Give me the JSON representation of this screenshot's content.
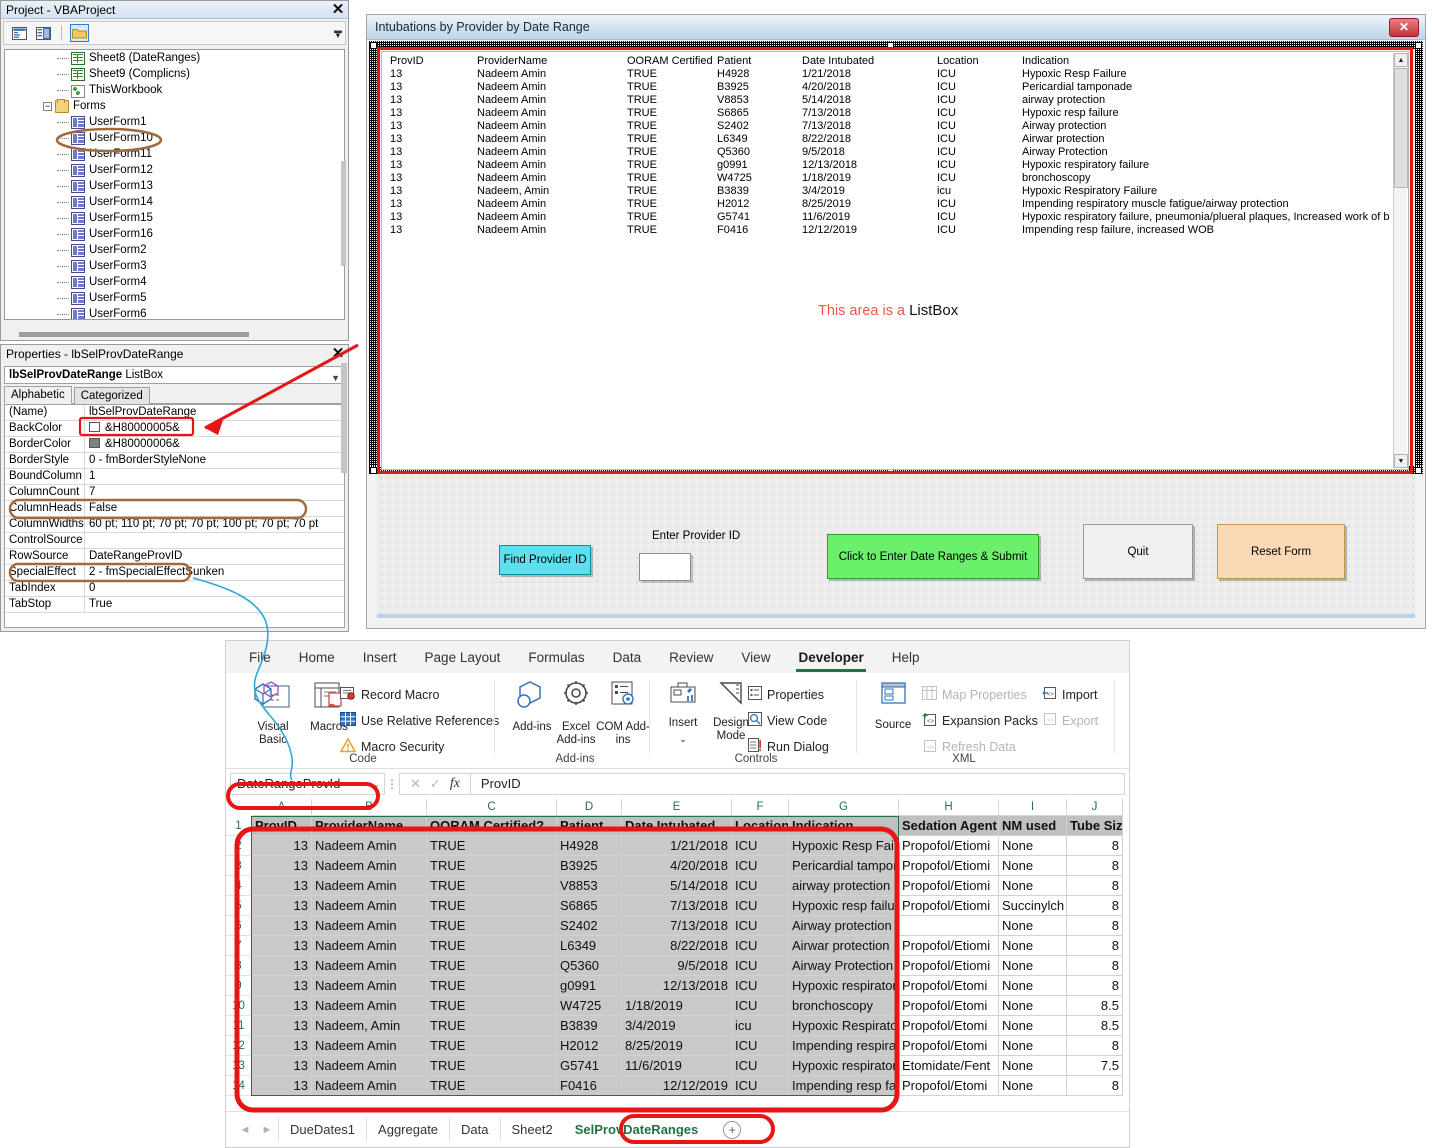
{
  "vbe": {
    "project": {
      "title": "Project - VBAProject",
      "close_label": "✕",
      "toolbar": [
        {
          "name": "view-code-icon",
          "label": "View Code"
        },
        {
          "name": "view-object-icon",
          "label": "View Object"
        },
        {
          "name": "toggle-folders-icon",
          "label": "Toggle Folders"
        }
      ],
      "tree": [
        {
          "label": "Sheet8 (DateRanges)",
          "icon": "sheet-icon",
          "indent": 3,
          "type": "sheet"
        },
        {
          "label": "Sheet9 (Complicns)",
          "icon": "sheet-icon",
          "indent": 3,
          "type": "sheet"
        },
        {
          "label": "ThisWorkbook",
          "icon": "workbook-icon",
          "indent": 3,
          "type": "workbook"
        },
        {
          "label": "Forms",
          "icon": "folder-icon",
          "indent": 2,
          "type": "folder",
          "expander": "−"
        },
        {
          "label": "UserForm1",
          "icon": "form-icon",
          "indent": 3,
          "type": "form"
        },
        {
          "label": "UserForm10",
          "icon": "form-icon",
          "indent": 3,
          "type": "form",
          "highlight": true
        },
        {
          "label": "UserForm11",
          "icon": "form-icon",
          "indent": 3,
          "type": "form"
        },
        {
          "label": "UserForm12",
          "icon": "form-icon",
          "indent": 3,
          "type": "form"
        },
        {
          "label": "UserForm13",
          "icon": "form-icon",
          "indent": 3,
          "type": "form"
        },
        {
          "label": "UserForm14",
          "icon": "form-icon",
          "indent": 3,
          "type": "form"
        },
        {
          "label": "UserForm15",
          "icon": "form-icon",
          "indent": 3,
          "type": "form"
        },
        {
          "label": "UserForm16",
          "icon": "form-icon",
          "indent": 3,
          "type": "form"
        },
        {
          "label": "UserForm2",
          "icon": "form-icon",
          "indent": 3,
          "type": "form"
        },
        {
          "label": "UserForm3",
          "icon": "form-icon",
          "indent": 3,
          "type": "form"
        },
        {
          "label": "UserForm4",
          "icon": "form-icon",
          "indent": 3,
          "type": "form"
        },
        {
          "label": "UserForm5",
          "icon": "form-icon",
          "indent": 3,
          "type": "form"
        },
        {
          "label": "UserForm6",
          "icon": "form-icon",
          "indent": 3,
          "type": "form"
        }
      ]
    },
    "properties": {
      "title": "Properties - lbSelProvDateRange",
      "close_label": "✕",
      "object_name": "lbSelProvDateRange",
      "object_type": "ListBox",
      "tabs": [
        {
          "label": "Alphabetic",
          "active": true
        },
        {
          "label": "Categorized",
          "active": false
        }
      ],
      "rows": [
        {
          "name": "(Name)",
          "value": "lbSelProvDateRange",
          "swatch": null,
          "highlight": "red"
        },
        {
          "name": "BackColor",
          "value": "&H80000005&",
          "swatch": "#ffffff"
        },
        {
          "name": "BorderColor",
          "value": "&H80000006&",
          "swatch": "#808080"
        },
        {
          "name": "BorderStyle",
          "value": "0 - fmBorderStyleNone",
          "swatch": null
        },
        {
          "name": "BoundColumn",
          "value": "1",
          "swatch": null
        },
        {
          "name": "ColumnCount",
          "value": "7",
          "swatch": null
        },
        {
          "name": "ColumnHeads",
          "value": "False",
          "swatch": null
        },
        {
          "name": "ColumnWidths",
          "value": "60 pt; 110 pt; 70 pt; 70 pt; 100 pt; 70 pt; 70 pt",
          "swatch": null,
          "highlight": "brown"
        },
        {
          "name": "ControlSource",
          "value": "",
          "swatch": null
        },
        {
          "name": "RowSource",
          "value": "DateRangeProvID",
          "swatch": null,
          "highlight": "brown"
        },
        {
          "name": "SpecialEffect",
          "value": "2 - fmSpecialEffectSunken",
          "swatch": null
        },
        {
          "name": "TabIndex",
          "value": "0",
          "swatch": null
        },
        {
          "name": "TabStop",
          "value": "True",
          "swatch": null
        }
      ]
    }
  },
  "userform": {
    "title": "Intubations by Provider by Date Range",
    "close_label": "✕",
    "annotation": {
      "prefix": "This area is a ",
      "emphasis": "ListBox"
    },
    "listbox": {
      "header": [
        "ProvID",
        "ProviderName",
        "OORAM Certified",
        "Patient",
        "Date Intubated",
        "Location",
        "Indication"
      ],
      "rows": [
        [
          "13",
          "Nadeem Amin",
          "TRUE",
          "H4928",
          "1/21/2018",
          "ICU",
          "Hypoxic Resp Failure"
        ],
        [
          "13",
          "Nadeem Amin",
          "TRUE",
          "B3925",
          "4/20/2018",
          "ICU",
          "Pericardial tamponade"
        ],
        [
          "13",
          "Nadeem Amin",
          "TRUE",
          "V8853",
          "5/14/2018",
          "ICU",
          "airway protection"
        ],
        [
          "13",
          "Nadeem Amin",
          "TRUE",
          "S6865",
          "7/13/2018",
          "ICU",
          "Hypoxic resp failure"
        ],
        [
          "13",
          "Nadeem Amin",
          "TRUE",
          "S2402",
          "7/13/2018",
          "ICU",
          "Airway protection"
        ],
        [
          "13",
          "Nadeem Amin",
          "TRUE",
          "L6349",
          "8/22/2018",
          "ICU",
          "Airwar protection"
        ],
        [
          "13",
          "Nadeem Amin",
          "TRUE",
          "Q5360",
          "9/5/2018",
          "ICU",
          "Airway Protection"
        ],
        [
          "13",
          "Nadeem Amin",
          "TRUE",
          "g0991",
          "12/13/2018",
          "ICU",
          "Hypoxic respiratory failure"
        ],
        [
          "13",
          "Nadeem Amin",
          "TRUE",
          "W4725",
          "1/18/2019",
          "ICU",
          "bronchoscopy"
        ],
        [
          "13",
          "Nadeem, Amin",
          "TRUE",
          "B3839",
          "3/4/2019",
          "icu",
          "Hypoxic Respiratory Failure"
        ],
        [
          "13",
          "Nadeem Amin",
          "TRUE",
          "H2012",
          "8/25/2019",
          "ICU",
          " Impending respiratory muscle fatigue/airway protection"
        ],
        [
          "13",
          "Nadeem Amin",
          "TRUE",
          "G5741",
          "11/6/2019",
          "ICU",
          "Hypoxic respiratory failure, pneumonia/plueral plaques, Increased work of b"
        ],
        [
          "13",
          "Nadeem Amin",
          "TRUE",
          "F0416",
          "12/12/2019",
          "ICU",
          "Impending resp failure, increased WOB"
        ]
      ]
    },
    "controls": {
      "find_button": "Find Provider ID",
      "provider_label": "Enter Provider ID",
      "provider_input_value": "",
      "submit_button": "Click to Enter Date Ranges & Submit",
      "quit_button": "Quit",
      "reset_button": "Reset Form"
    }
  },
  "excel": {
    "ribbon_tabs": [
      {
        "label": "File",
        "active": false
      },
      {
        "label": "Home",
        "active": false
      },
      {
        "label": "Insert",
        "active": false
      },
      {
        "label": "Page Layout",
        "active": false
      },
      {
        "label": "Formulas",
        "active": false
      },
      {
        "label": "Data",
        "active": false
      },
      {
        "label": "Review",
        "active": false
      },
      {
        "label": "View",
        "active": false
      },
      {
        "label": "Developer",
        "active": true
      },
      {
        "label": "Help",
        "active": false
      }
    ],
    "ribbon_groups": [
      {
        "label": "Code"
      },
      {
        "label": "Add-ins"
      },
      {
        "label": "Controls"
      },
      {
        "label": "XML"
      }
    ],
    "code_group": {
      "visual_basic": "Visual Basic",
      "macros": "Macros",
      "record_macro": "Record Macro",
      "use_relative_references": "Use Relative References",
      "macro_security": "Macro Security"
    },
    "addins_group": {
      "addins": "Add-ins",
      "excel_addins": "Excel Add-ins",
      "com_addins": "COM Add-ins"
    },
    "controls_group": {
      "insert": "Insert",
      "design_mode": "Design Mode",
      "properties": "Properties",
      "view_code": "View Code",
      "run_dialog": "Run Dialog"
    },
    "xml_group": {
      "source": "Source",
      "map_properties": "Map Properties",
      "expansion_packs": "Expansion Packs",
      "refresh_data": "Refresh Data",
      "import": "Import",
      "export": "Export"
    },
    "formula_bar": {
      "name_box": "DateRangeProvId",
      "cancel_icon": "✕",
      "enter_icon": "✓",
      "fx_icon": "fx",
      "formula_value": "ProvID"
    },
    "sheet": {
      "column_headers": [
        "A",
        "B",
        "C",
        "D",
        "E",
        "F",
        "G",
        "H",
        "I",
        "J"
      ],
      "row_numbers": [
        "1",
        "2",
        "3",
        "4",
        "5",
        "6",
        "7",
        "8",
        "9",
        "10",
        "11",
        "12",
        "13",
        "14"
      ],
      "header_row": [
        "ProvID",
        "ProviderName",
        "OORAM Certified?",
        "Patient",
        "Date Intubated",
        "Location",
        "Indication",
        "Sedation Agent",
        "NM used",
        "Tube Size"
      ],
      "rows": [
        [
          "13",
          "Nadeem Amin",
          "TRUE",
          "H4928",
          "1/21/2018",
          "ICU",
          "Hypoxic Resp Failur",
          "Propofol/Etiomi",
          "None",
          "8"
        ],
        [
          "13",
          "Nadeem Amin",
          "TRUE",
          "B3925",
          "4/20/2018",
          "ICU",
          "Pericardial tampon",
          "Propofol/Etiomi",
          "None",
          "8"
        ],
        [
          "13",
          "Nadeem Amin",
          "TRUE",
          "V8853",
          "5/14/2018",
          "ICU",
          "airway protection",
          "Propofol/Etiomi",
          "None",
          "8"
        ],
        [
          "13",
          "Nadeem Amin",
          "TRUE",
          "S6865",
          "7/13/2018",
          "ICU",
          "Hypoxic resp failure",
          "Propofol/Etiomi",
          "Succinylch",
          "8"
        ],
        [
          "13",
          "Nadeem Amin",
          "TRUE",
          "S2402",
          "7/13/2018",
          "ICU",
          "Airway protection",
          "",
          "None",
          "8"
        ],
        [
          "13",
          "Nadeem Amin",
          "TRUE",
          "L6349",
          "8/22/2018",
          "ICU",
          "Airwar protection",
          "Propofol/Etiomi",
          "None",
          "8"
        ],
        [
          "13",
          "Nadeem Amin",
          "TRUE",
          "Q5360",
          "9/5/2018",
          "ICU",
          "Airway Protection",
          "Propofol/Etiomi",
          "None",
          "8"
        ],
        [
          "13",
          "Nadeem Amin",
          "TRUE",
          "g0991",
          "12/13/2018",
          "ICU",
          "Hypoxic respiratory",
          "Propofol/Etomi",
          "None",
          "8"
        ],
        [
          "13",
          "Nadeem Amin",
          "TRUE",
          "W4725",
          "1/18/2019",
          "ICU",
          "bronchoscopy",
          "Propofol/Etomi",
          "None",
          "8.5"
        ],
        [
          "13",
          "Nadeem, Amin",
          "TRUE",
          "B3839",
          "3/4/2019",
          "icu",
          "Hypoxic Respirator",
          "Propofol/Etomi",
          "None",
          "8.5"
        ],
        [
          "13",
          "Nadeem Amin",
          "TRUE",
          "H2012",
          "8/25/2019",
          "ICU",
          " Impending respirat",
          "Propofol/Etomi",
          "None",
          "8"
        ],
        [
          "13",
          "Nadeem Amin",
          "TRUE",
          "G5741",
          "11/6/2019",
          "ICU",
          "Hypoxic respiratory",
          "Etomidate/Fent",
          "None",
          "7.5"
        ],
        [
          "13",
          "Nadeem Amin",
          "TRUE",
          "F0416",
          "12/12/2019",
          "ICU",
          "Impending resp fail",
          "Propofol/Etomi",
          "None",
          "8"
        ]
      ],
      "date_right_aligned": [
        true,
        true,
        true,
        true,
        true,
        true,
        true,
        true,
        false,
        false,
        false,
        false,
        true
      ]
    },
    "sheet_tabs": [
      {
        "label": "DueDates1",
        "active": false
      },
      {
        "label": "Aggregate",
        "active": false
      },
      {
        "label": "Data",
        "active": false
      },
      {
        "label": "Sheet2",
        "active": false
      },
      {
        "label": "SelProvDateRanges",
        "active": true
      }
    ],
    "add_sheet_label": "+",
    "nav_prev": "◄",
    "nav_next": "►"
  },
  "annotation_colors": {
    "red": "#e81515",
    "brown": "#a06a3c",
    "blue": "#2fa8d8"
  }
}
